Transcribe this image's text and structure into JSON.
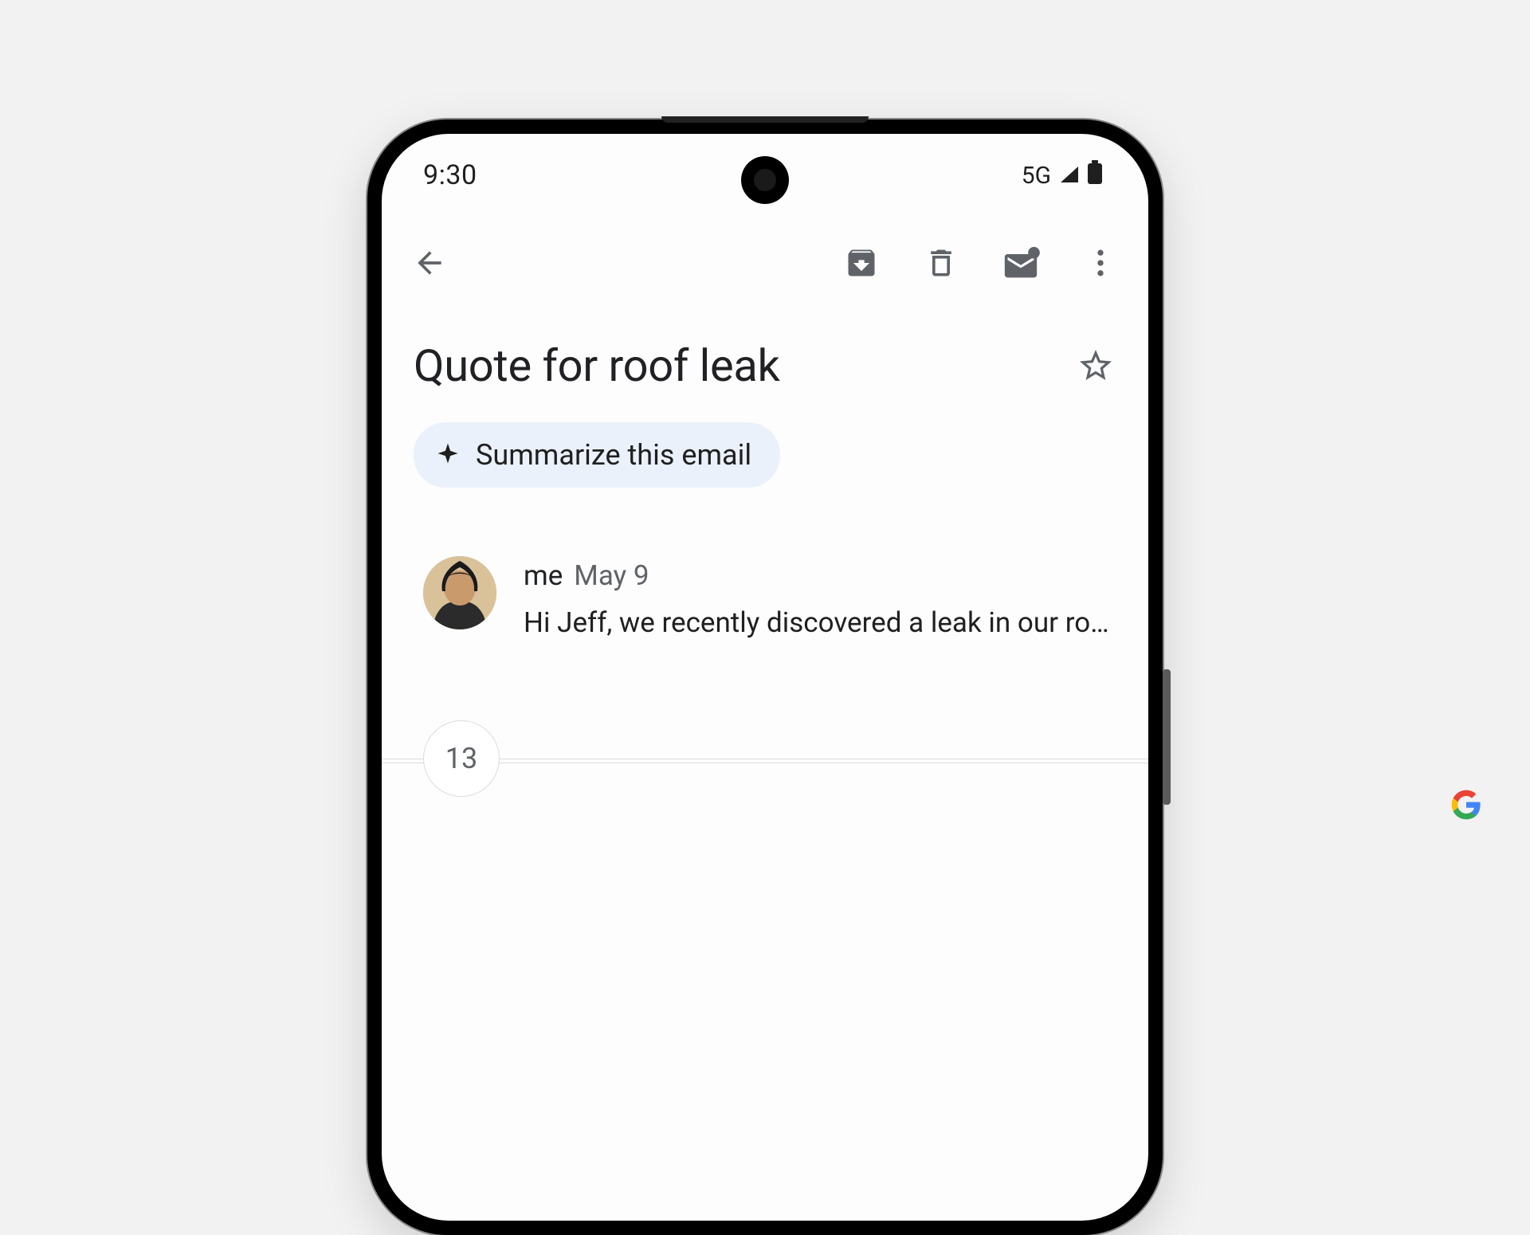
{
  "status": {
    "time": "9:30",
    "network": "5G"
  },
  "subject": "Quote for roof leak",
  "summarize_label": "Summarize this email",
  "message": {
    "sender": "me",
    "date": "May 9",
    "preview": "Hi Jeff, we recently discovered a leak in our roof..."
  },
  "thread_count": "13"
}
